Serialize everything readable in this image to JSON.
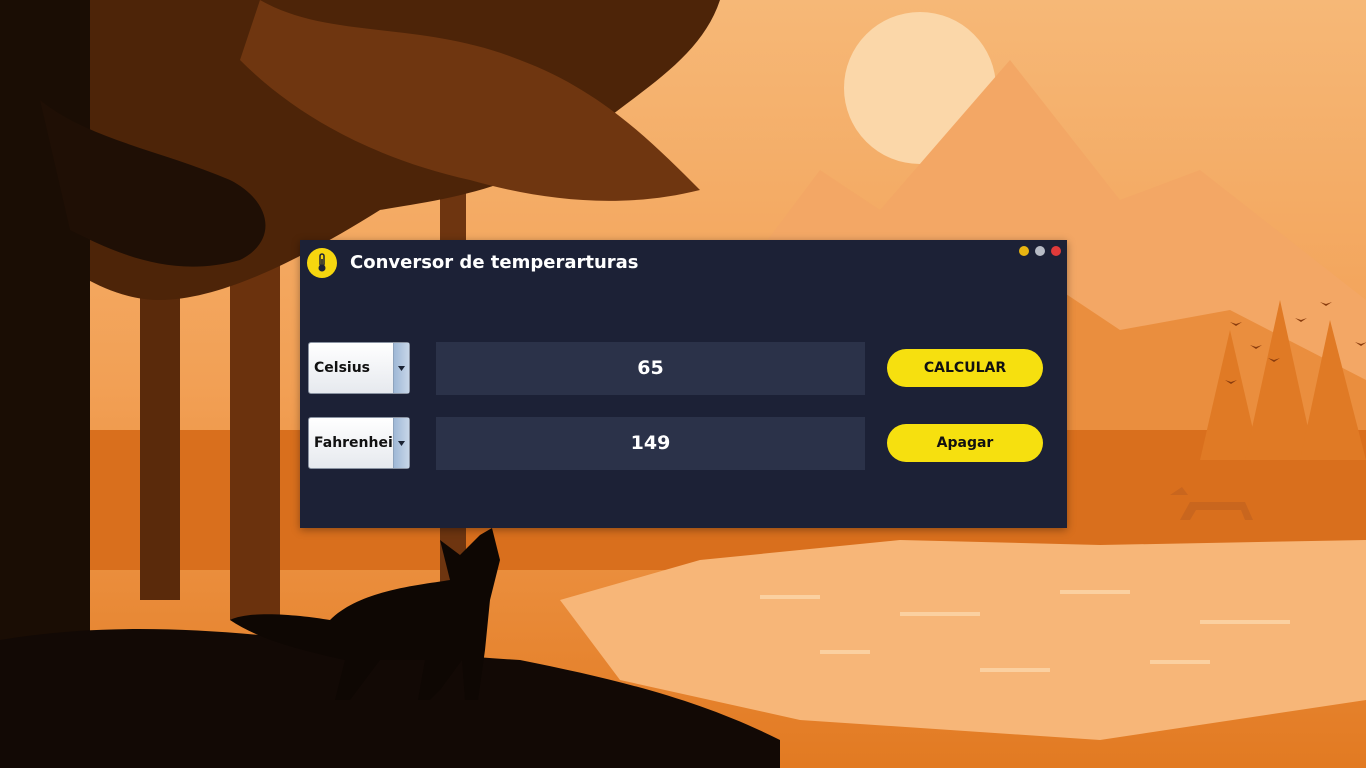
{
  "window": {
    "title": "Conversor de temperarturas",
    "icon": "thermometer-icon",
    "controls": {
      "minimize_color": "#e8b511",
      "maximize_color": "#b7bcc6",
      "close_color": "#e03a3a"
    }
  },
  "converter": {
    "from_unit": "Celsius",
    "to_unit": "Fahrenheit",
    "input_value": "65",
    "output_value": "149",
    "calculate_label": "CALCULAR",
    "clear_label": "Apagar"
  },
  "colors": {
    "accent": "#f6e00f",
    "window_bg": "#1c2136",
    "field_bg": "#2b3249"
  }
}
